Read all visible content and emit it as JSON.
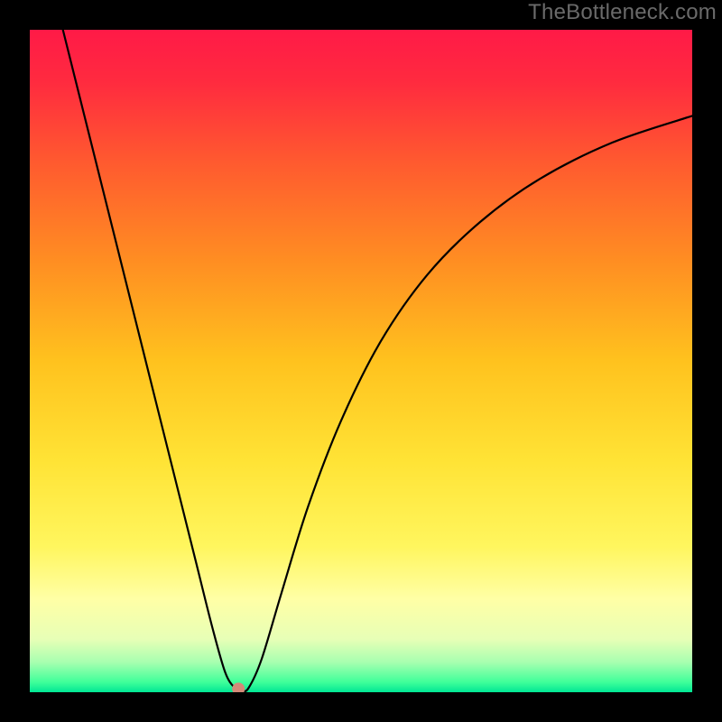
{
  "watermark": "TheBottleneck.com",
  "chart_data": {
    "type": "line",
    "title": "",
    "xlabel": "",
    "ylabel": "",
    "xlim": [
      0,
      100
    ],
    "ylim": [
      0,
      100
    ],
    "background_gradient": {
      "stops": [
        {
          "offset": 0.0,
          "color": "#ff1a47"
        },
        {
          "offset": 0.08,
          "color": "#ff2b3f"
        },
        {
          "offset": 0.2,
          "color": "#ff5a2f"
        },
        {
          "offset": 0.35,
          "color": "#ff8e22"
        },
        {
          "offset": 0.5,
          "color": "#ffc21e"
        },
        {
          "offset": 0.65,
          "color": "#ffe335"
        },
        {
          "offset": 0.78,
          "color": "#fff65e"
        },
        {
          "offset": 0.86,
          "color": "#ffffa6"
        },
        {
          "offset": 0.92,
          "color": "#e7ffb6"
        },
        {
          "offset": 0.955,
          "color": "#a7ffb0"
        },
        {
          "offset": 0.985,
          "color": "#3fff9a"
        },
        {
          "offset": 1.0,
          "color": "#00e694"
        }
      ]
    },
    "series": [
      {
        "name": "bottleneck-curve",
        "color": "#000000",
        "points": [
          {
            "x": 5.0,
            "y": 100.0
          },
          {
            "x": 9.0,
            "y": 84.0
          },
          {
            "x": 13.0,
            "y": 68.0
          },
          {
            "x": 17.0,
            "y": 52.0
          },
          {
            "x": 21.0,
            "y": 36.0
          },
          {
            "x": 25.0,
            "y": 20.0
          },
          {
            "x": 27.5,
            "y": 10.0
          },
          {
            "x": 29.5,
            "y": 3.0
          },
          {
            "x": 31.0,
            "y": 0.6
          },
          {
            "x": 32.0,
            "y": 0.3
          },
          {
            "x": 33.0,
            "y": 0.6
          },
          {
            "x": 35.0,
            "y": 5.0
          },
          {
            "x": 38.0,
            "y": 15.0
          },
          {
            "x": 42.0,
            "y": 28.0
          },
          {
            "x": 47.0,
            "y": 41.0
          },
          {
            "x": 53.0,
            "y": 53.0
          },
          {
            "x": 60.0,
            "y": 63.0
          },
          {
            "x": 68.0,
            "y": 71.0
          },
          {
            "x": 77.0,
            "y": 77.5
          },
          {
            "x": 88.0,
            "y": 83.0
          },
          {
            "x": 100.0,
            "y": 87.0
          }
        ]
      }
    ],
    "marker": {
      "name": "optimum-point",
      "x": 31.5,
      "y": 0.5,
      "color": "#d48a78",
      "radius_px": 7
    }
  }
}
